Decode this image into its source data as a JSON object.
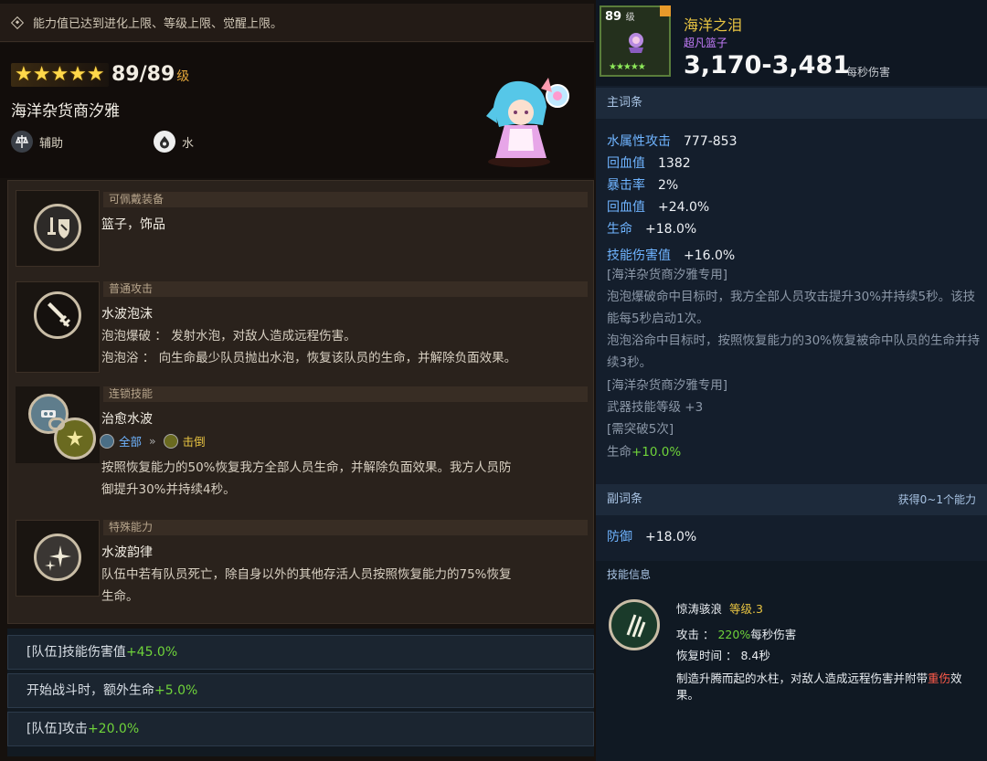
{
  "notice": "能力值已达到进化上限、等级上限、觉醒上限。",
  "hero": {
    "stars": "★★★★★",
    "level": "89/89",
    "level_unit": "级",
    "name": "海洋杂货商汐雅",
    "role": "辅助",
    "element": "水"
  },
  "skills": [
    {
      "category": "可佩戴装备",
      "title": "篮子，饰品",
      "icon": "sword-shield-icon"
    },
    {
      "category": "普通攻击",
      "title": "水波泡沫",
      "lines": [
        "泡泡爆破 ： 发射水泡，对敌人造成远程伤害。",
        "泡泡浴 ： 向生命最少队员抛出水泡，恢复该队员的生命，并解除负面效果。"
      ],
      "icon": "sword-icon"
    },
    {
      "category": "连锁技能",
      "title": "治愈水波",
      "chain_from": "全部",
      "chain_to": "击倒",
      "lines": [
        "按照恢复能力的50%恢复我方全部人员生命，并解除负面效果。我方人员防",
        "御提升30%并持续4秒。"
      ],
      "icon": "chain-icon"
    },
    {
      "category": "特殊能力",
      "title": "水波韵律",
      "lines": [
        "队伍中若有队员死亡，除自身以外的其他存活人员按照恢复能力的75%恢复",
        "生命。"
      ],
      "icon": "sparkle-icon"
    }
  ],
  "bonuses": [
    {
      "label": "[队伍]技能伤害值",
      "value": "+45.0%"
    },
    {
      "label": "开始战斗时，额外生命",
      "value": "+5.0%"
    },
    {
      "label": "[队伍]攻击",
      "value": "+20.0%"
    }
  ],
  "item": {
    "level": "89",
    "level_unit": "级",
    "stars": "★★★★★",
    "name": "海洋之泪",
    "subtitle": "超凡篮子",
    "dps": "3,170-3,481",
    "dps_unit": "每秒伤害"
  },
  "main_stats_header": "主词条",
  "main_stats": [
    {
      "key": "水属性攻击",
      "value": "777-853"
    },
    {
      "key": "回血值",
      "value": "1382"
    },
    {
      "key": "暴击率",
      "value": "2%"
    },
    {
      "key": "回血值",
      "value": "+24.0%"
    },
    {
      "key": "生命",
      "value": "+18.0%"
    },
    {
      "key": "技能伤害值",
      "value": "+16.0%"
    }
  ],
  "notes": {
    "exclusive1": "[海洋杂货商汐雅专用]",
    "effect1": "泡泡爆破命中目标时，我方全部人员攻击提升30%并持续5秒。该技能每5秒启动1次。",
    "effect2": "泡泡浴命中目标时，按照恢复能力的30%恢复被命中队员的生命并持续3秒。",
    "exclusive2": "[海洋杂货商汐雅专用]",
    "weapon_skill": "武器技能等级 +3",
    "breakthrough": "[需突破5次]",
    "life_key": "生命",
    "life_val": "+10.0%"
  },
  "sub_stats_header": "副词条",
  "sub_stats_right": "获得0~1个能力",
  "sub_stats": [
    {
      "key": "防御",
      "value": "+18.0%"
    }
  ],
  "skill_info": {
    "header": "技能信息",
    "name": "惊涛骇浪",
    "level": "等级.3",
    "attack_label": "攻击 ：",
    "attack_value": "220%",
    "attack_unit": "每秒伤害",
    "cooldown_label": "恢复时间 ：",
    "cooldown_value": "8.4秒",
    "desc_a": "制造升腾而起的水柱，对敌人造成远程伤害并附带",
    "desc_b": "重伤",
    "desc_c": "效",
    "desc_d": "果。"
  },
  "colors": {
    "green": "#6fd33a",
    "yellow": "#e9c542",
    "blue": "#6fb4ff",
    "purple": "#c77eff"
  }
}
